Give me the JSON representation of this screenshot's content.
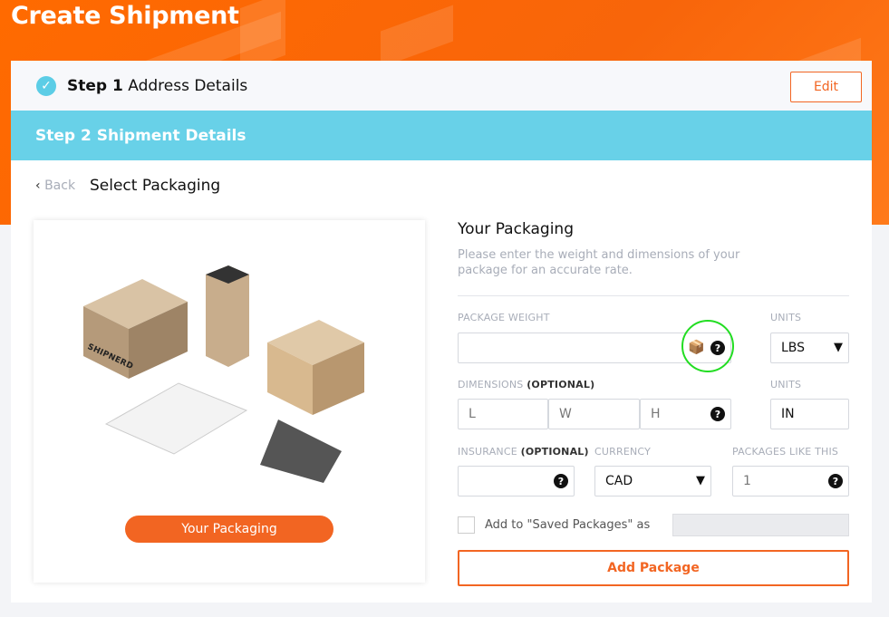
{
  "header": {
    "title": "Create Shipment"
  },
  "step1": {
    "number": "Step 1",
    "label": "Address Details",
    "edit_label": "Edit",
    "icon": "check-circle-icon"
  },
  "step2": {
    "number": "Step 2",
    "label": "Shipment Details"
  },
  "nav": {
    "back": "Back",
    "title": "Select Packaging"
  },
  "illustration": {
    "button": "Your Packaging",
    "brand": "SHIPNERD"
  },
  "form": {
    "title": "Your Packaging",
    "description": "Please enter the weight and dimensions of your package for an accurate rate.",
    "weight_label": "PACKAGE WEIGHT",
    "weight_value": "",
    "units_label": "UNITS",
    "weight_units": "LBS",
    "dimensions_label": "DIMENSIONS",
    "optional": "(OPTIONAL)",
    "l_placeholder": "L",
    "w_placeholder": "W",
    "h_placeholder": "H",
    "dim_units_label": "UNITS",
    "dim_units": "IN",
    "insurance_label": "INSURANCE",
    "currency_label": "CURRENCY",
    "currency": "CAD",
    "packages_label": "PACKAGES LIKE THIS",
    "packages_value": "1",
    "save_label": "Add to \"Saved Packages\" as",
    "save_value": "",
    "add_button": "Add Package"
  },
  "colors": {
    "accent": "#f26522",
    "step2": "#68d1e8",
    "highlight": "#22dd22"
  }
}
